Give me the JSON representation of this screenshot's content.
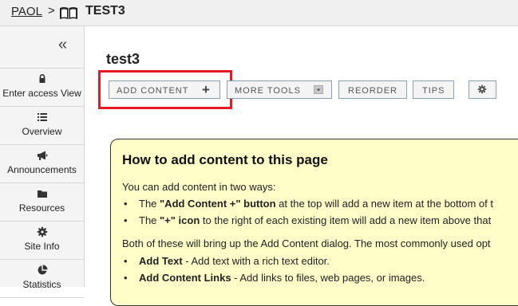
{
  "breadcrumb": {
    "site": "PAOL",
    "separator": ">",
    "page": "TEST3"
  },
  "sidebar": {
    "collapse_symbol": "«",
    "items": [
      {
        "label": "Enter access View",
        "icon": "lock-icon"
      },
      {
        "label": "Overview",
        "icon": "list-icon"
      },
      {
        "label": "Announcements",
        "icon": "megaphone-icon"
      },
      {
        "label": "Resources",
        "icon": "folder-icon"
      },
      {
        "label": "Site Info",
        "icon": "gear-icon"
      },
      {
        "label": "Statistics",
        "icon": "pie-chart-icon"
      }
    ]
  },
  "main": {
    "title": "test3",
    "toolbar": {
      "add_content": "ADD CONTENT",
      "add_symbol": "+",
      "more_tools": "MORE TOOLS",
      "reorder": "REORDER",
      "tips": "TIPS"
    },
    "info": {
      "heading": "How to add content to this page",
      "intro": "You can add content in two ways:",
      "bullet1_bold": "\"Add Content +\" button",
      "bullet1_pre": "The ",
      "bullet1_post": " at the top will add a new item at the bottom of t",
      "bullet2_bold": "\"+\" icon",
      "bullet2_pre": "The ",
      "bullet2_post": " to the right of each existing item will add a new item above that",
      "para2": "Both of these will bring up the Add Content dialog. The most commonly used opt",
      "item1_bold": "Add Text",
      "item1_text": " - Add text with a rich text editor.",
      "item2_bold": "Add Content Links",
      "item2_text": " - Add links to files, web pages, or images."
    }
  },
  "colors": {
    "highlight": "#e41b23",
    "info_bg": "#fffdc8",
    "button_border": "#8aa1b1"
  }
}
